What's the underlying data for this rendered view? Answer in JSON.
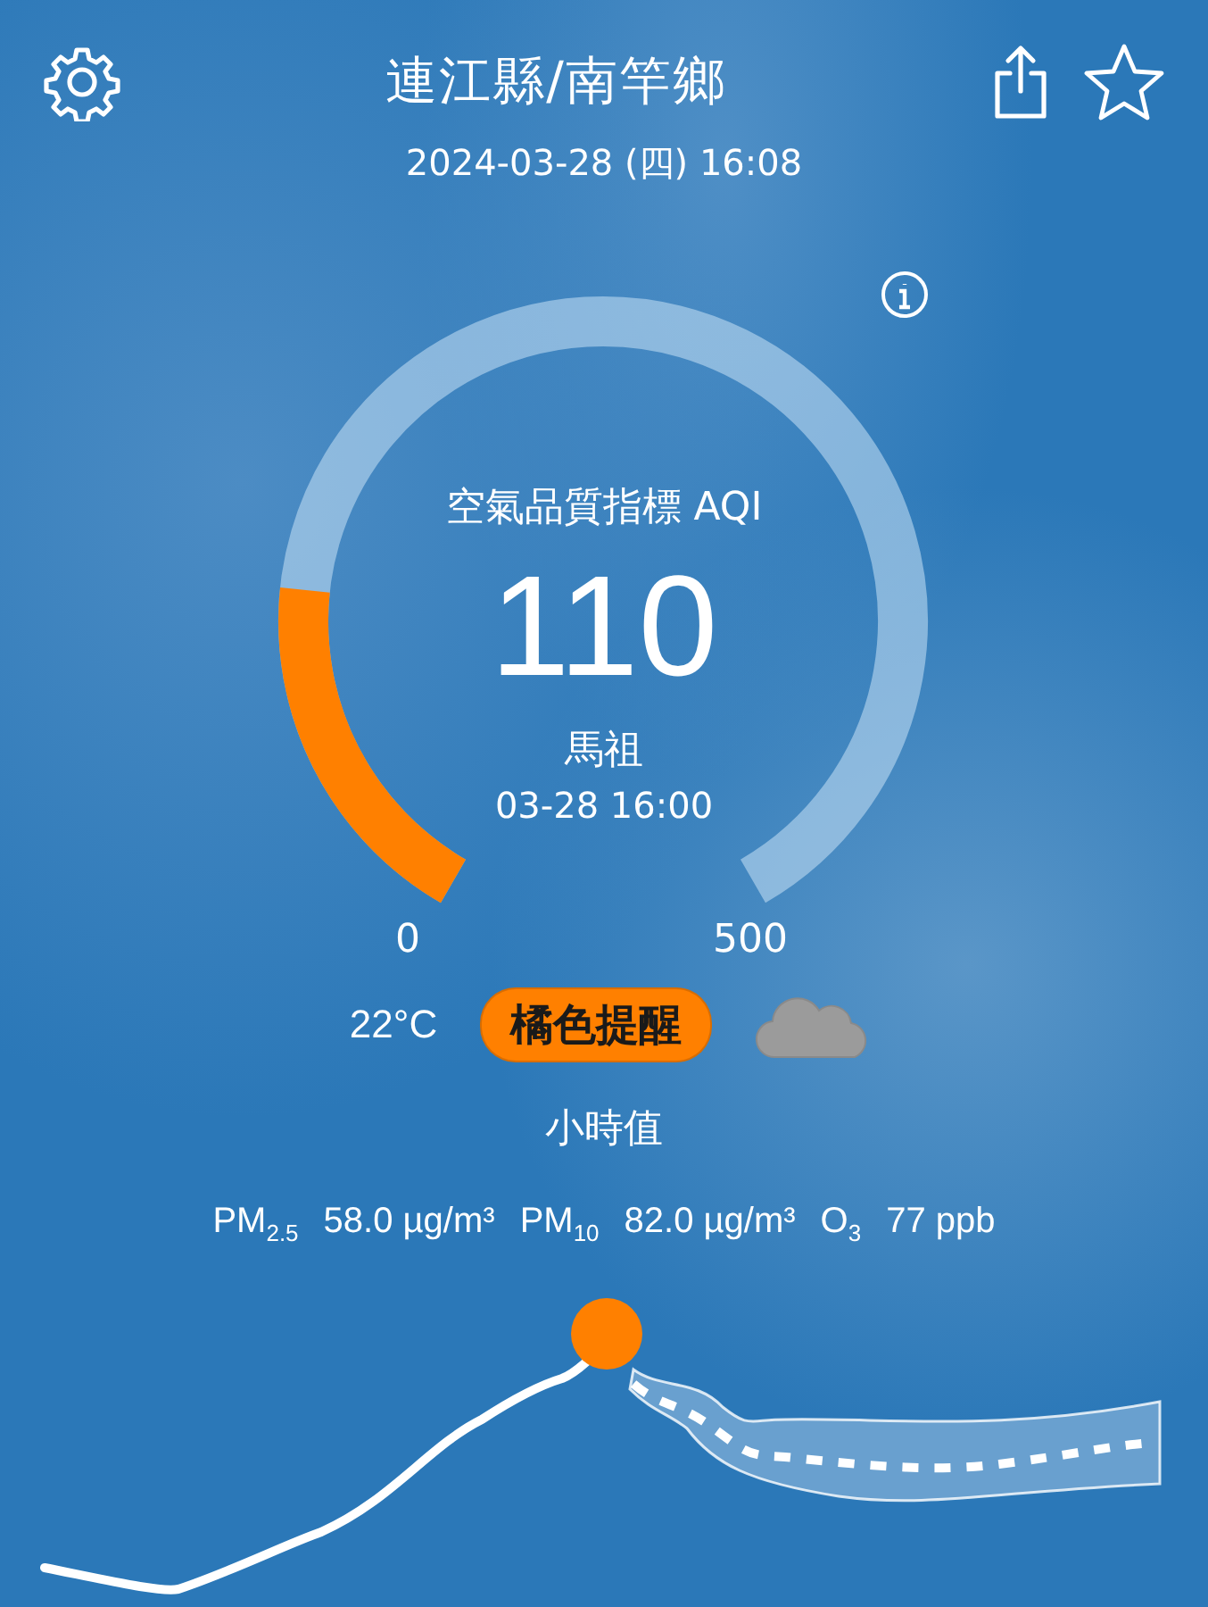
{
  "header": {
    "location": "連江縣/南竿鄉",
    "datetime": "2024-03-28 (四) 16:08"
  },
  "gauge": {
    "title": "空氣品質指標 AQI",
    "value": "110",
    "color": "#ff8000",
    "station": "馬祖",
    "time": "03-28 16:00",
    "min_label": "0",
    "max_label": "500"
  },
  "conditions": {
    "temperature": "22°C",
    "alert": {
      "label": "橘色提醒",
      "color": "#ff8000"
    }
  },
  "period": "小時值",
  "pollutants": [
    {
      "label": "PM$_{2.5}$",
      "value": "58.0 µg/m³"
    },
    {
      "label": "PM$_{10}$",
      "value": "82.0 µg/m³"
    },
    {
      "label": "O$_{3}$",
      "value": "77 ppb"
    }
  ]
}
